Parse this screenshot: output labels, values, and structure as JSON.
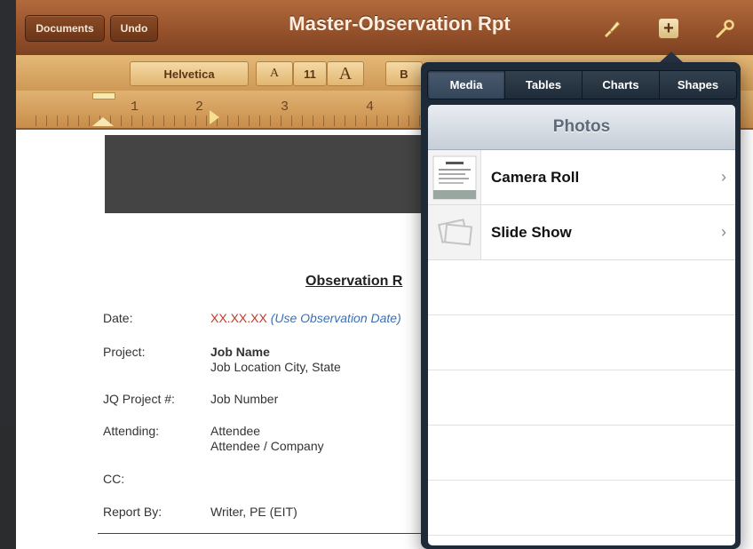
{
  "toolbar": {
    "documents_label": "Documents",
    "undo_label": "Undo",
    "title": "Master-Observation Rpt",
    "icons": [
      "paintbrush-icon",
      "insert-plus-icon",
      "wrench-icon"
    ],
    "plus_glyph": "+"
  },
  "format_bar": {
    "font": "Helvetica",
    "small_a": "A",
    "size": "11",
    "large_a": "A",
    "bold": "B"
  },
  "ruler": {
    "numbers": [
      "1",
      "2",
      "3",
      "4"
    ]
  },
  "document": {
    "report_title": "Observation R",
    "rows": [
      {
        "label": "Date:",
        "value": "XX.XX.XX",
        "note": "(Use Observation Date)"
      },
      {
        "label": "Project:",
        "value": "Job Name",
        "value2": "Job Location City, State"
      },
      {
        "label": "JQ Project #:",
        "value": "Job Number"
      },
      {
        "label": "Attending:",
        "value": "Attendee",
        "value2": "Attendee / Company"
      },
      {
        "label": "CC:",
        "value": ""
      },
      {
        "label": "Report By:",
        "value": "Writer, PE (EIT)"
      }
    ],
    "colors": {
      "date_value": "#c0392b",
      "date_note": "#3a6fb5"
    }
  },
  "popover": {
    "tabs": [
      "Media",
      "Tables",
      "Charts",
      "Shapes"
    ],
    "active_tab": "Media",
    "header": "Photos",
    "items": [
      {
        "title": "Camera Roll",
        "icon": "camera-roll-thumbnail"
      },
      {
        "title": "Slide Show",
        "icon": "slide-show-thumbnail"
      }
    ],
    "chevron": "›"
  }
}
